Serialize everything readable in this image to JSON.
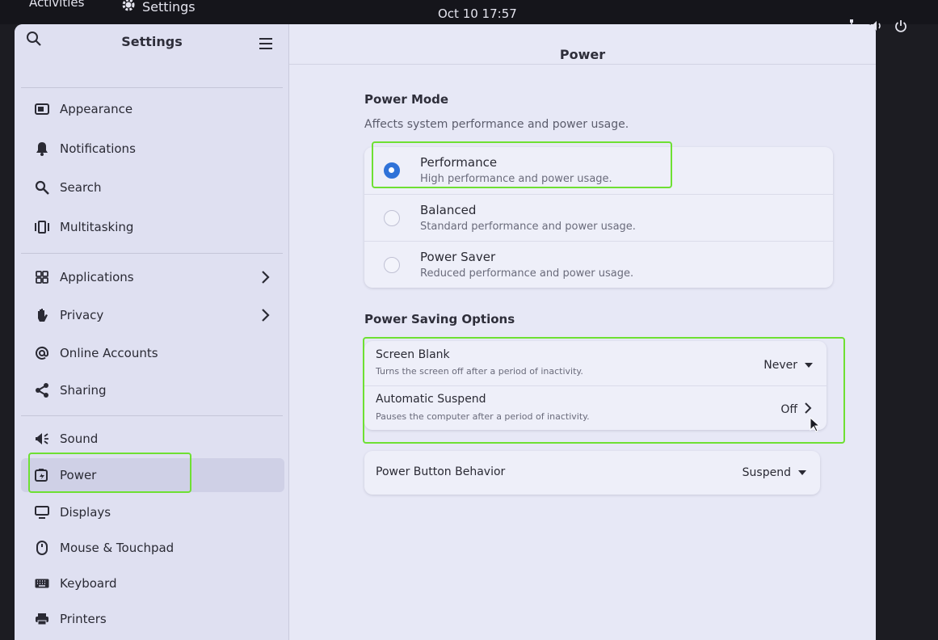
{
  "topbar": {
    "activities": "Activities",
    "app_name": "Settings",
    "clock": "Oct 10  17:57"
  },
  "sidebar": {
    "title": "Settings",
    "items": [
      {
        "label": "Appearance",
        "icon": "appearance-icon"
      },
      {
        "label": "Notifications",
        "icon": "bell-icon"
      },
      {
        "label": "Search",
        "icon": "search-icon"
      },
      {
        "label": "Multitasking",
        "icon": "multitasking-icon"
      },
      {
        "label": "Applications",
        "icon": "grid-icon"
      },
      {
        "label": "Privacy",
        "icon": "hand-icon"
      },
      {
        "label": "Online Accounts",
        "icon": "at-icon"
      },
      {
        "label": "Sharing",
        "icon": "share-icon"
      },
      {
        "label": "Sound",
        "icon": "speaker-icon"
      },
      {
        "label": "Power",
        "icon": "battery-icon"
      },
      {
        "label": "Displays",
        "icon": "monitor-icon"
      },
      {
        "label": "Mouse & Touchpad",
        "icon": "mouse-icon"
      },
      {
        "label": "Keyboard",
        "icon": "keyboard-icon"
      },
      {
        "label": "Printers",
        "icon": "printer-icon"
      }
    ]
  },
  "main": {
    "title": "Power",
    "power_mode": {
      "title": "Power Mode",
      "subtitle": "Affects system performance and power usage.",
      "options": [
        {
          "title": "Performance",
          "subtitle": "High performance and power usage.",
          "selected": true
        },
        {
          "title": "Balanced",
          "subtitle": "Standard performance and power usage.",
          "selected": false
        },
        {
          "title": "Power Saver",
          "subtitle": "Reduced performance and power usage.",
          "selected": false
        }
      ]
    },
    "saving": {
      "title": "Power Saving Options",
      "screen_blank": {
        "title": "Screen Blank",
        "subtitle": "Turns the screen off after a period of inactivity.",
        "value": "Never"
      },
      "auto_suspend": {
        "title": "Automatic Suspend",
        "subtitle": "Pauses the computer after a period of inactivity.",
        "value": "Off"
      }
    },
    "power_button": {
      "title": "Power Button Behavior",
      "value": "Suspend"
    }
  },
  "colors": {
    "accent": "#2f72d8",
    "highlight": "#6ee033"
  }
}
